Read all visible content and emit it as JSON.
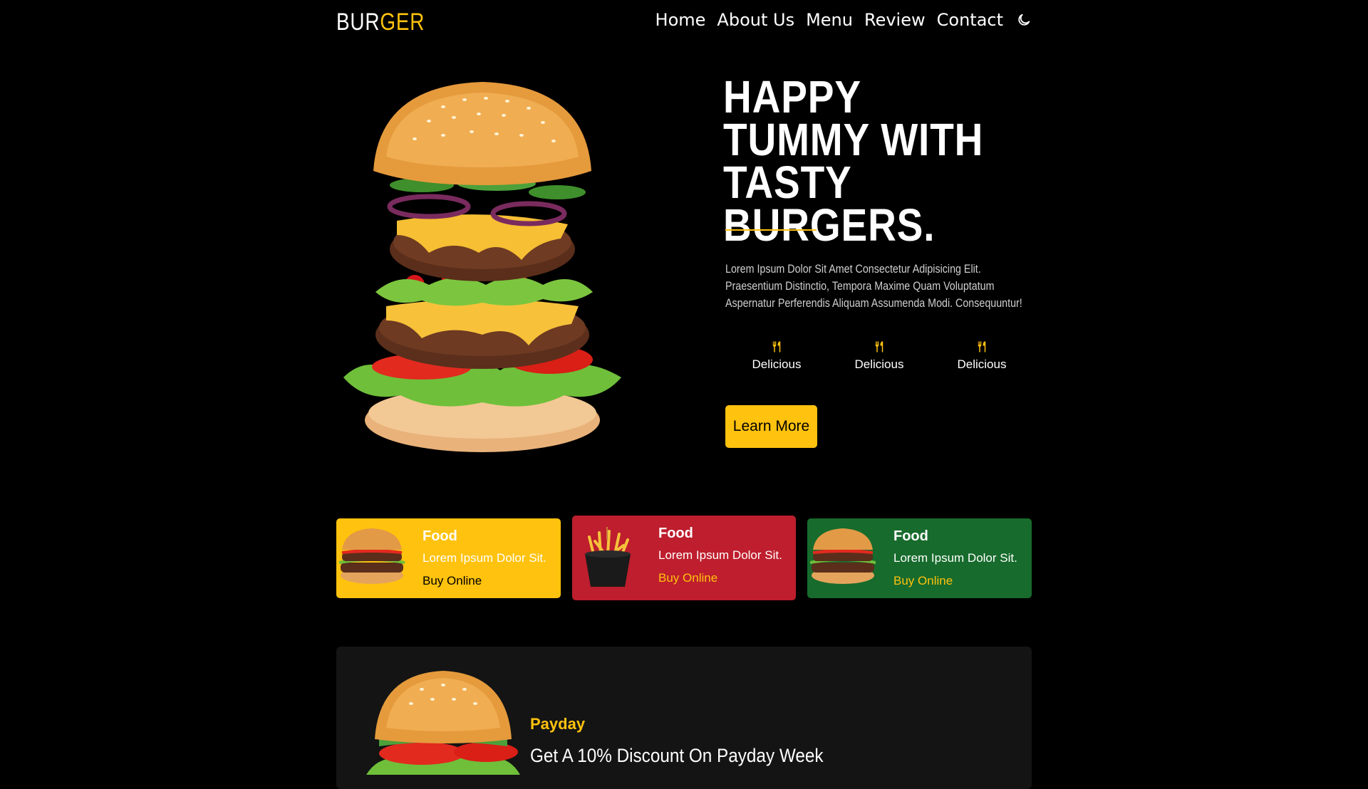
{
  "header": {
    "logo_part1": "BUR",
    "logo_part2": "GER",
    "nav": [
      "Home",
      "About Us",
      "Menu",
      "Review",
      "Contact"
    ],
    "theme_icon": "moon-icon"
  },
  "hero": {
    "title": "HAPPY TUMMY WITH TASTY BURGERS.",
    "description": "Lorem Ipsum Dolor Sit Amet Consectetur Adipisicing Elit. Praesentium Distinctio, Tempora Maxime Quam Voluptatum Aspernatur Perferendis Aliquam Assumenda Modi. Consequuntur!",
    "features": [
      {
        "icon": "fork-knife-icon",
        "label": "Delicious"
      },
      {
        "icon": "fork-knife-icon",
        "label": "Delicious"
      },
      {
        "icon": "fork-knife-icon",
        "label": "Delicious"
      }
    ],
    "button_label": "Learn More"
  },
  "cards": [
    {
      "title": "Food",
      "subtitle": "Lorem Ipsum Dolor Sit.",
      "link": "Buy Online",
      "color": "#ffc20e"
    },
    {
      "title": "Food",
      "subtitle": "Lorem Ipsum Dolor Sit.",
      "link": "Buy Online",
      "color": "#be1e2d"
    },
    {
      "title": "Food",
      "subtitle": "Lorem Ipsum Dolor Sit.",
      "link": "Buy Online",
      "color": "#176b2c"
    }
  ],
  "promo": {
    "eyebrow": "Payday",
    "title": "Get A 10% Discount On Payday Week"
  },
  "colors": {
    "accent": "#ffc20e",
    "background": "#000000"
  }
}
